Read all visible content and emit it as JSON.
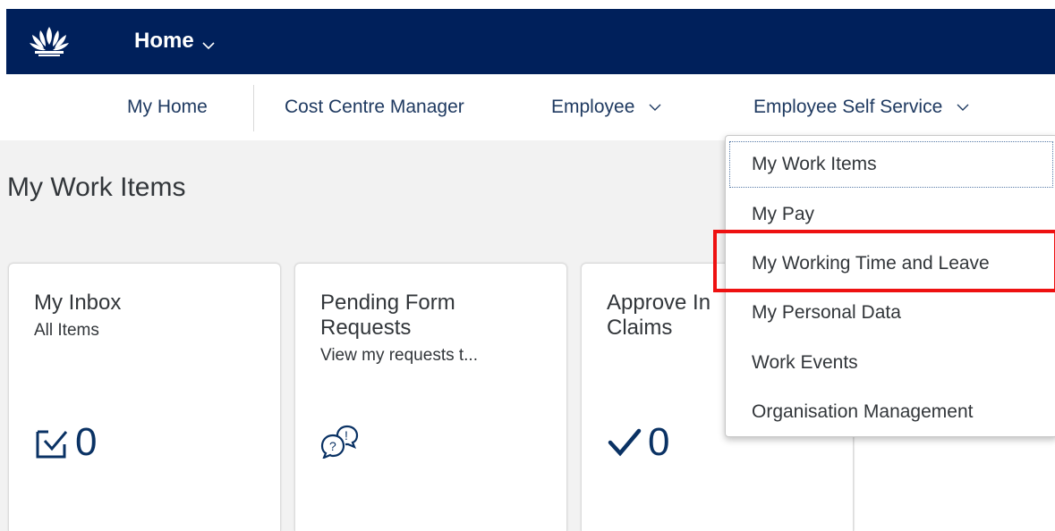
{
  "shell": {
    "home_label": "Home",
    "logo_icon": "waratah-logo",
    "bar_color": "#00205b"
  },
  "nav": {
    "items": [
      {
        "label": "My Home"
      },
      {
        "label": "Cost Centre Manager"
      },
      {
        "label": "Employee"
      },
      {
        "label": "Employee Self Service"
      }
    ]
  },
  "main": {
    "section_title": "My Work Items",
    "tiles": [
      {
        "title": "My Inbox",
        "subtitle": "All Items",
        "kpi": "0",
        "icon": "inbox-check-icon"
      },
      {
        "title_line1": "Pending Form",
        "title_line2": "Requests",
        "subtitle": "View my requests t...",
        "icon": "chat-question-icon"
      },
      {
        "title_line1": "Approve In",
        "title_line2": "Claims",
        "kpi": "0",
        "icon": "checkmark-icon"
      }
    ]
  },
  "dropdown": {
    "items": [
      {
        "label": "My Work Items"
      },
      {
        "label": "My Pay"
      },
      {
        "label": "My Working Time and Leave"
      },
      {
        "label": "My Personal Data"
      },
      {
        "label": "Work Events"
      },
      {
        "label": "Organisation Management"
      }
    ],
    "highlight_color": "#ee1111"
  }
}
